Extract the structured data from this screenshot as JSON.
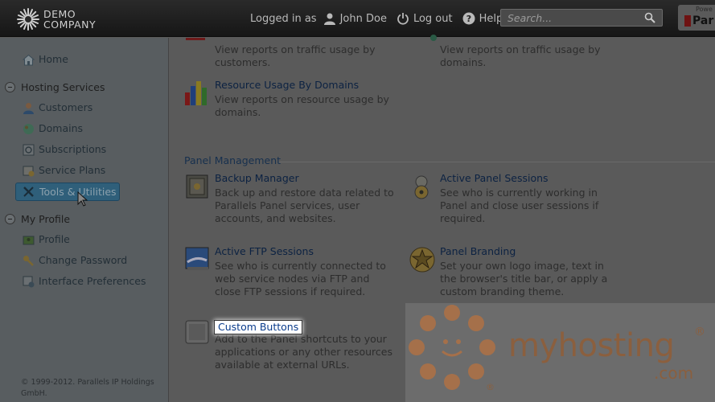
{
  "brand": {
    "line1": "DEMO",
    "line2": "COMPANY"
  },
  "header": {
    "logged_in_as": "Logged in as",
    "user_name": "John Doe",
    "logout": "Log out",
    "help": "Help",
    "search_placeholder": "Search...",
    "powered_by": "Powe",
    "powered_logo": "Par"
  },
  "sidebar": {
    "home": "Home",
    "hosting_services": "Hosting Services",
    "hosting_items": [
      "Customers",
      "Domains",
      "Subscriptions",
      "Service Plans",
      "Tools & Utilities"
    ],
    "my_profile": "My Profile",
    "profile_items": [
      "Profile",
      "Change Password",
      "Interface Preferences"
    ],
    "copyright_1": "© 1999-2012. Parallels IP Holdings",
    "copyright_2": "GmbH."
  },
  "main": {
    "top_left_desc": "View reports on traffic usage by customers.",
    "top_right_desc": "View reports on traffic usage by domains.",
    "resource_usage": {
      "title": "Resource Usage By Domains",
      "desc": "View reports on resource usage by domains."
    },
    "panel_management_title": "Panel Management",
    "items": [
      {
        "title": "Backup Manager",
        "desc": "Back up and restore data related to Parallels Panel services, user accounts, and websites."
      },
      {
        "title": "Active Panel Sessions",
        "desc": "See who is currently working in Panel and close user sessions if required."
      },
      {
        "title": "Active FTP Sessions",
        "desc": "See who is currently connected to web service nodes via FTP and close FTP sessions if required."
      },
      {
        "title": "Panel Branding",
        "desc": "Set your own logo image, text in the browser's title bar, or apply a custom branding theme."
      },
      {
        "title": "Custom Buttons",
        "desc": "Add to the Panel shortcuts to your applications or any other resources available at external URLs."
      }
    ]
  },
  "watermark": {
    "brand": "myhosting",
    "suffix": ".com",
    "reg": "®"
  },
  "colors": {
    "accent_link": "#0c2242",
    "selected_nav": "#2f5f7a",
    "watermark": "#8b5f3e"
  }
}
